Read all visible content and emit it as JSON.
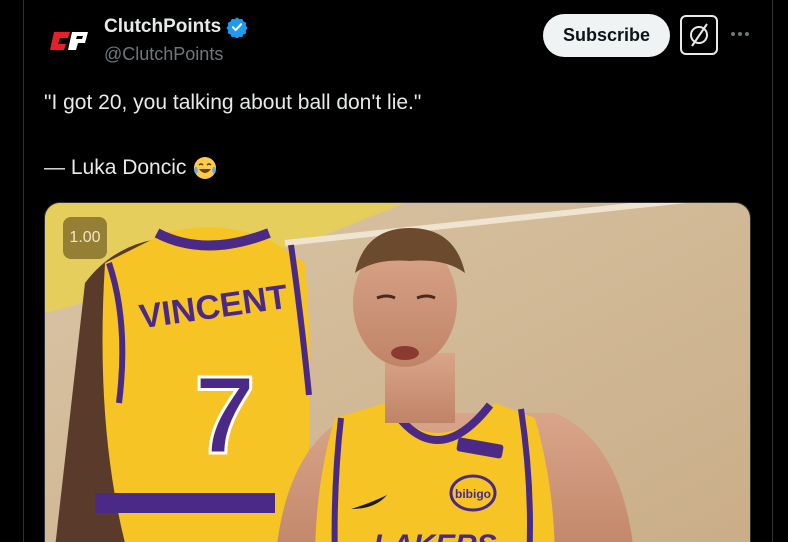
{
  "account": {
    "name": "ClutchPoints",
    "handle": "@ClutchPoints",
    "avatar_icon": "clutchpoints-logo",
    "verified_icon": "verified-badge-icon",
    "verified_color": "#1d9bf0"
  },
  "actions": {
    "subscribe_label": "Subscribe",
    "grok_icon": "grok-icon",
    "more_icon": "more-options-icon"
  },
  "tweet": {
    "line1": "\"I got 20, you talking about ball don't lie.\"",
    "line2": "— Luka Doncic",
    "emoji": "tears-of-joy-emoji"
  },
  "media": {
    "playback_speed": "1.00",
    "jersey_back_name": "VINCENT",
    "jersey_back_number": "7",
    "jersey_front_text": "LAKERS",
    "sponsor_patch": "bibigo"
  },
  "colors": {
    "background": "#000000",
    "text_primary": "#e7e9ea",
    "text_secondary": "#71767b",
    "lakers_gold": "#f5c518",
    "lakers_purple": "#4a2a86"
  }
}
